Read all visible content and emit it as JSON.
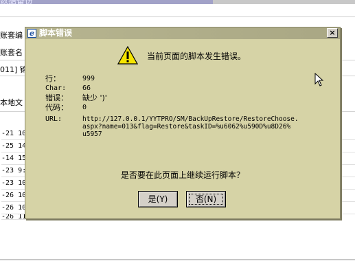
{
  "background": {
    "header_title": "数据备份",
    "form_lines": [
      "账套编",
      "账套名",
      "011] 锦"
    ],
    "section_label": "本地文",
    "table_rows": [
      "-21 10",
      "-25 14",
      "-14 15",
      "-23 9:",
      "-23 10",
      "-26 10",
      "-26 10",
      "-26 11"
    ]
  },
  "dialog": {
    "title": "脚本错误",
    "close_label": "×",
    "headline": "当前页面的脚本发生错误。",
    "details": {
      "line_label": "行：",
      "line_value": "999",
      "char_label": "Char:",
      "char_value": "66",
      "error_label": "错误：",
      "error_value": "缺少 ')'",
      "code_label": "代码：",
      "code_value": "0",
      "url_label": "URL:",
      "url_value": "http://127.0.0.1/YYTPRO/SM/BackUpRestore/RestoreChoose.\naspx?name=013&flag=Restore&taskID=%u6062%u590D%u8D26%\nu5957"
    },
    "question": "是否要在此页面上继续运行脚本？",
    "yes_label": "是(Y)",
    "no_label": "否(N)"
  },
  "colors": {
    "dialog_bg": "#d6d3a6",
    "titlebar": "#b7b590",
    "warning_yellow": "#f5e400"
  },
  "icons": [
    "ie-icon",
    "warning-icon",
    "close-icon",
    "mouse-cursor-icon"
  ]
}
